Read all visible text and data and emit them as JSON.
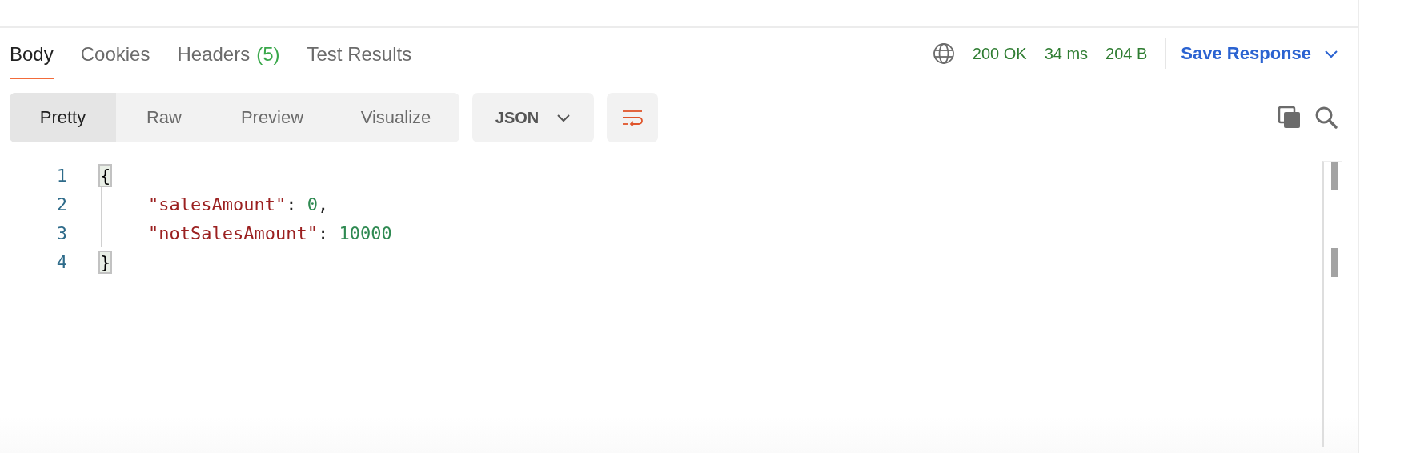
{
  "response_tabs": [
    {
      "label": "Body",
      "selected": true
    },
    {
      "label": "Cookies",
      "selected": false
    },
    {
      "label": "Headers",
      "count": "(5)",
      "selected": false
    },
    {
      "label": "Test Results",
      "selected": false
    }
  ],
  "status": {
    "code": "200 OK",
    "time": "34 ms",
    "size": "204 B"
  },
  "save_response": {
    "label": "Save Response"
  },
  "view_modes": [
    {
      "label": "Pretty",
      "selected": true
    },
    {
      "label": "Raw",
      "selected": false
    },
    {
      "label": "Preview",
      "selected": false
    },
    {
      "label": "Visualize",
      "selected": false
    }
  ],
  "format_dropdown": {
    "value": "JSON"
  },
  "code_lines": [
    {
      "number": "1",
      "indented": false,
      "tokens": [
        {
          "kind": "brace",
          "text": "{"
        }
      ]
    },
    {
      "number": "2",
      "indented": true,
      "tokens": [
        {
          "kind": "key",
          "text": "\"salesAmount\""
        },
        {
          "kind": "punct",
          "text": ": "
        },
        {
          "kind": "number",
          "text": "0"
        },
        {
          "kind": "punct",
          "text": ","
        }
      ]
    },
    {
      "number": "3",
      "indented": true,
      "tokens": [
        {
          "kind": "key",
          "text": "\"notSalesAmount\""
        },
        {
          "kind": "punct",
          "text": ": "
        },
        {
          "kind": "number",
          "text": "10000"
        }
      ]
    },
    {
      "number": "4",
      "indented": false,
      "tokens": [
        {
          "kind": "brace",
          "text": "}"
        }
      ]
    }
  ]
}
